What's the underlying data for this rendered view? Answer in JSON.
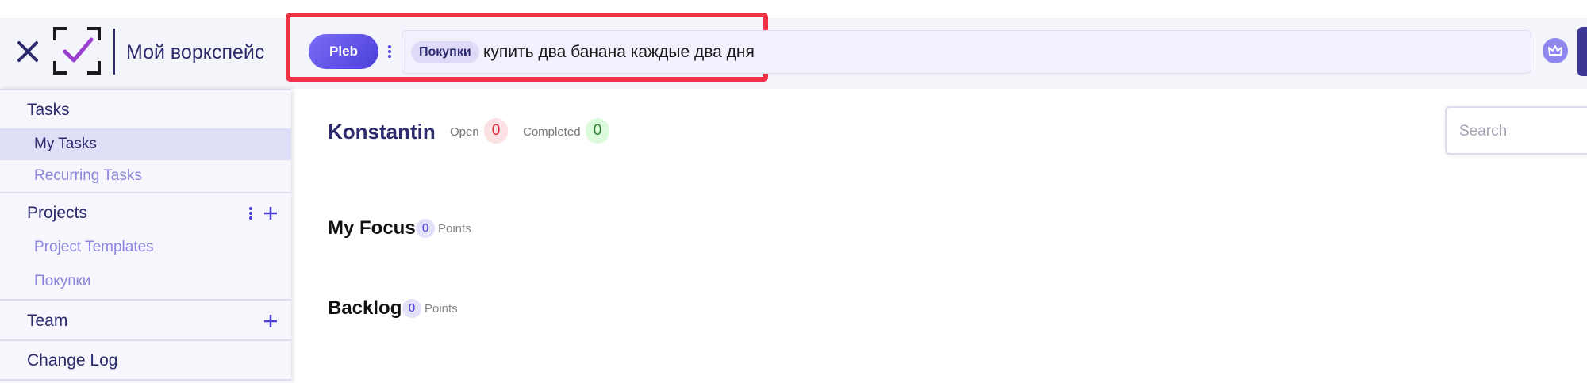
{
  "header": {
    "workspace_name": "Мой воркспейс",
    "user_pill": "Pleb",
    "task_input": {
      "project_tag": "Покупки",
      "text": "купить два банана каждые два дня"
    },
    "icons": [
      "close-icon",
      "logo-check-icon",
      "more-vertical-icon",
      "crown-icon"
    ]
  },
  "sidebar": {
    "sections": [
      {
        "label": "Tasks",
        "items": [
          {
            "label": "My Tasks",
            "active": true
          },
          {
            "label": "Recurring Tasks"
          }
        ]
      },
      {
        "label": "Projects",
        "items": [
          {
            "label": "Project Templates"
          },
          {
            "label": "Покупки"
          }
        ]
      },
      {
        "label": "Team"
      },
      {
        "label": "Change Log"
      }
    ]
  },
  "main": {
    "user_name": "Konstantin",
    "stats": {
      "open_label": "Open",
      "open_count": "0",
      "completed_label": "Completed",
      "completed_count": "0"
    },
    "search_placeholder": "Search",
    "focus": {
      "title": "My Focus",
      "points": "0",
      "points_label": "Points"
    },
    "backlog": {
      "title": "Backlog",
      "points": "0",
      "points_label": "Points"
    }
  },
  "colors": {
    "accent": "#4b3fd9",
    "brand_dark": "#2b2b6e",
    "highlight": "#ef3347",
    "open_badge": "#e0273a",
    "completed_badge": "#2e7d32"
  }
}
